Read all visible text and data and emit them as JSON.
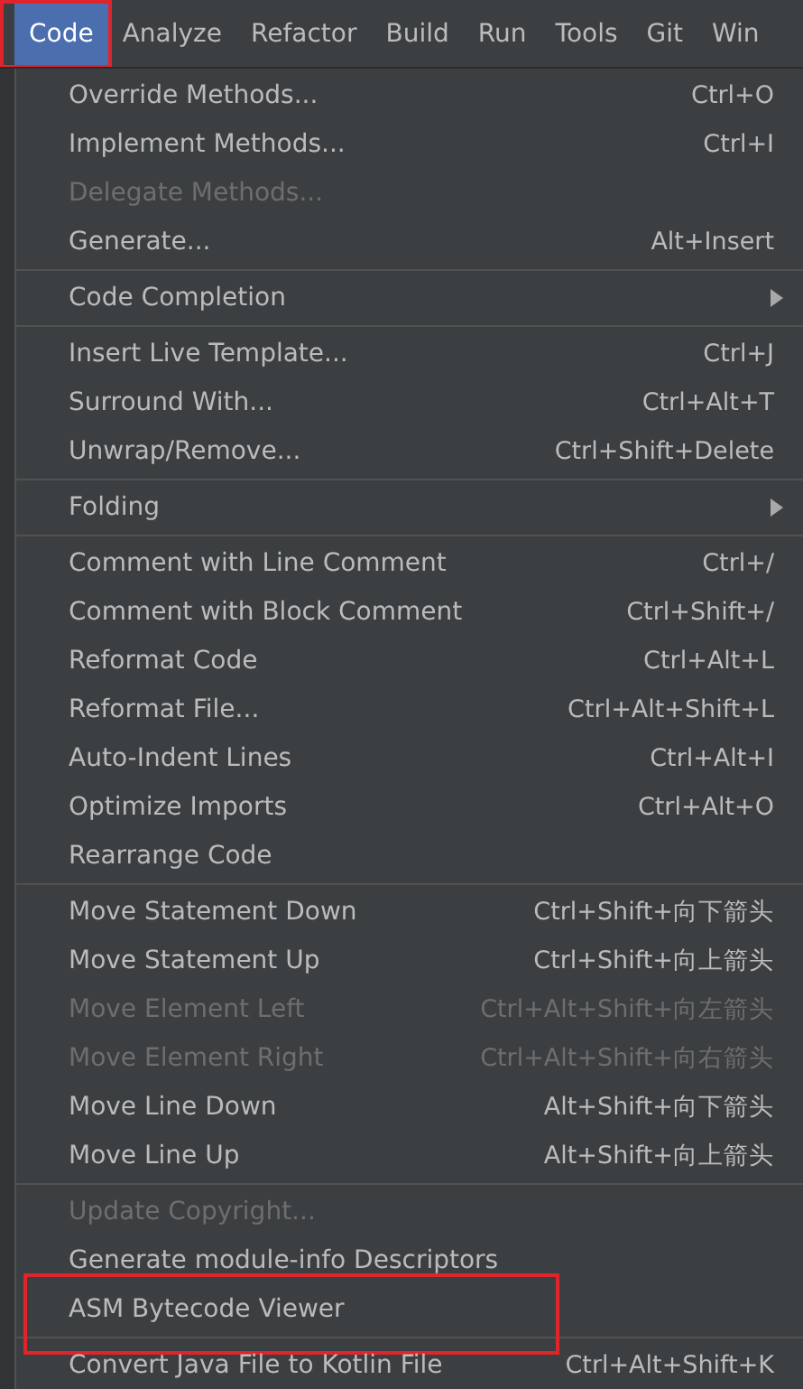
{
  "menu_bar": [
    {
      "label": "Code",
      "selected": true,
      "highlighted": true
    },
    {
      "label": "Analyze",
      "selected": false,
      "highlighted": false
    },
    {
      "label": "Refactor",
      "selected": false,
      "highlighted": false
    },
    {
      "label": "Build",
      "selected": false,
      "highlighted": false
    },
    {
      "label": "Run",
      "selected": false,
      "highlighted": false
    },
    {
      "label": "Tools",
      "selected": false,
      "highlighted": false
    },
    {
      "label": "Git",
      "selected": false,
      "highlighted": false
    },
    {
      "label": "Win",
      "selected": false,
      "highlighted": false
    }
  ],
  "menu": {
    "sections": [
      {
        "items": [
          {
            "label": "Override Methods...",
            "shortcut": "Ctrl+O",
            "disabled": false
          },
          {
            "label": "Implement Methods...",
            "shortcut": "Ctrl+I",
            "disabled": false
          },
          {
            "label": "Delegate Methods...",
            "disabled": true
          },
          {
            "label": "Generate...",
            "shortcut": "Alt+Insert",
            "disabled": false
          }
        ]
      },
      {
        "items": [
          {
            "label": "Code Completion",
            "submenu": true,
            "disabled": false
          }
        ]
      },
      {
        "items": [
          {
            "label": "Insert Live Template...",
            "shortcut": "Ctrl+J",
            "disabled": false
          },
          {
            "label": "Surround With...",
            "shortcut": "Ctrl+Alt+T",
            "disabled": false
          },
          {
            "label": "Unwrap/Remove...",
            "shortcut": "Ctrl+Shift+Delete",
            "disabled": false
          }
        ]
      },
      {
        "items": [
          {
            "label": "Folding",
            "submenu": true,
            "disabled": false
          }
        ]
      },
      {
        "items": [
          {
            "label": "Comment with Line Comment",
            "shortcut": "Ctrl+/",
            "disabled": false
          },
          {
            "label": "Comment with Block Comment",
            "shortcut": "Ctrl+Shift+/",
            "disabled": false
          },
          {
            "label": "Reformat Code",
            "shortcut": "Ctrl+Alt+L",
            "disabled": false
          },
          {
            "label": "Reformat File...",
            "shortcut": "Ctrl+Alt+Shift+L",
            "disabled": false
          },
          {
            "label": "Auto-Indent Lines",
            "shortcut": "Ctrl+Alt+I",
            "disabled": false
          },
          {
            "label": "Optimize Imports",
            "shortcut": "Ctrl+Alt+O",
            "disabled": false
          },
          {
            "label": "Rearrange Code",
            "disabled": false
          }
        ]
      },
      {
        "items": [
          {
            "label": "Move Statement Down",
            "shortcut": "Ctrl+Shift+向下箭头",
            "disabled": false
          },
          {
            "label": "Move Statement Up",
            "shortcut": "Ctrl+Shift+向上箭头",
            "disabled": false
          },
          {
            "label": "Move Element Left",
            "shortcut": "Ctrl+Alt+Shift+向左箭头",
            "disabled": true
          },
          {
            "label": "Move Element Right",
            "shortcut": "Ctrl+Alt+Shift+向右箭头",
            "disabled": true
          },
          {
            "label": "Move Line Down",
            "shortcut": "Alt+Shift+向下箭头",
            "disabled": false
          },
          {
            "label": "Move Line Up",
            "shortcut": "Alt+Shift+向上箭头",
            "disabled": false
          }
        ]
      },
      {
        "items": [
          {
            "label": "Update Copyright...",
            "disabled": true
          },
          {
            "label": "Generate module-info Descriptors",
            "disabled": false
          },
          {
            "label": "ASM Bytecode Viewer",
            "disabled": false,
            "highlighted": true
          }
        ]
      },
      {
        "items": [
          {
            "label": "Convert Java File to Kotlin File",
            "shortcut": "Ctrl+Alt+Shift+K",
            "disabled": false
          }
        ]
      }
    ]
  }
}
